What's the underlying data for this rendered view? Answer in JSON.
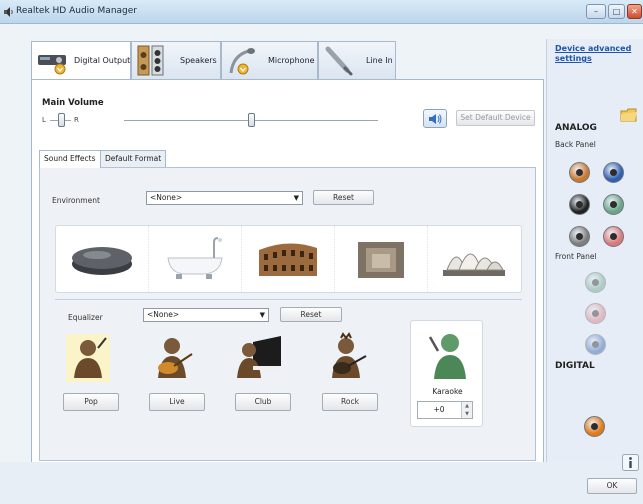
{
  "window": {
    "title": "Realtek HD Audio Manager",
    "minimize_glyph": "–",
    "maximize_glyph": "□",
    "close_glyph": "✕"
  },
  "device_tabs": [
    {
      "label": "Digital Output",
      "icon": "digital-output-icon",
      "active": true
    },
    {
      "label": "Speakers",
      "icon": "speakers-icon",
      "active": false
    },
    {
      "label": "Microphone",
      "icon": "microphone-icon",
      "active": false
    },
    {
      "label": "Line In",
      "icon": "line-in-icon",
      "active": false
    }
  ],
  "main_volume": {
    "label": "Main Volume",
    "left_label": "L",
    "right_label": "R",
    "balance": 0.5,
    "level": 0.5,
    "mute_icon": "speaker-volume-icon",
    "set_default_label": "Set Default Device"
  },
  "effect_tabs": [
    {
      "label": "Sound Effects",
      "active": true
    },
    {
      "label": "Default Format",
      "active": false
    }
  ],
  "environment": {
    "label": "Environment",
    "selected": "<None>",
    "reset_label": "Reset",
    "icons": [
      "stone-disc-icon",
      "bathtub-icon",
      "colosseum-icon",
      "stone-room-icon",
      "opera-house-icon"
    ]
  },
  "equalizer": {
    "label": "Equalizer",
    "selected": "<None>",
    "reset_label": "Reset",
    "presets": [
      {
        "label": "Pop",
        "icon": "pop-singer-icon"
      },
      {
        "label": "Live",
        "icon": "live-guitarist-icon"
      },
      {
        "label": "Club",
        "icon": "club-pianist-icon"
      },
      {
        "label": "Rock",
        "icon": "rock-guitarist-icon"
      }
    ]
  },
  "karaoke": {
    "label": "Karaoke",
    "value": "+0",
    "icon": "karaoke-singer-icon"
  },
  "right_panel": {
    "device_advanced_link": "Device advanced settings",
    "analog_title": "ANALOG",
    "back_panel_title": "Back Panel",
    "front_panel_title": "Front Panel",
    "digital_title": "DIGITAL",
    "colors": {
      "orange": "#c9782e",
      "blue": "#2f5fb0",
      "black": "#222222",
      "green": "#6aa587",
      "gray": "#7d7d7d",
      "pink": "#d97a7a",
      "digital": "#e07a1a"
    }
  },
  "bottom": {
    "ok_label": "OK",
    "info_icon": "info-icon"
  }
}
